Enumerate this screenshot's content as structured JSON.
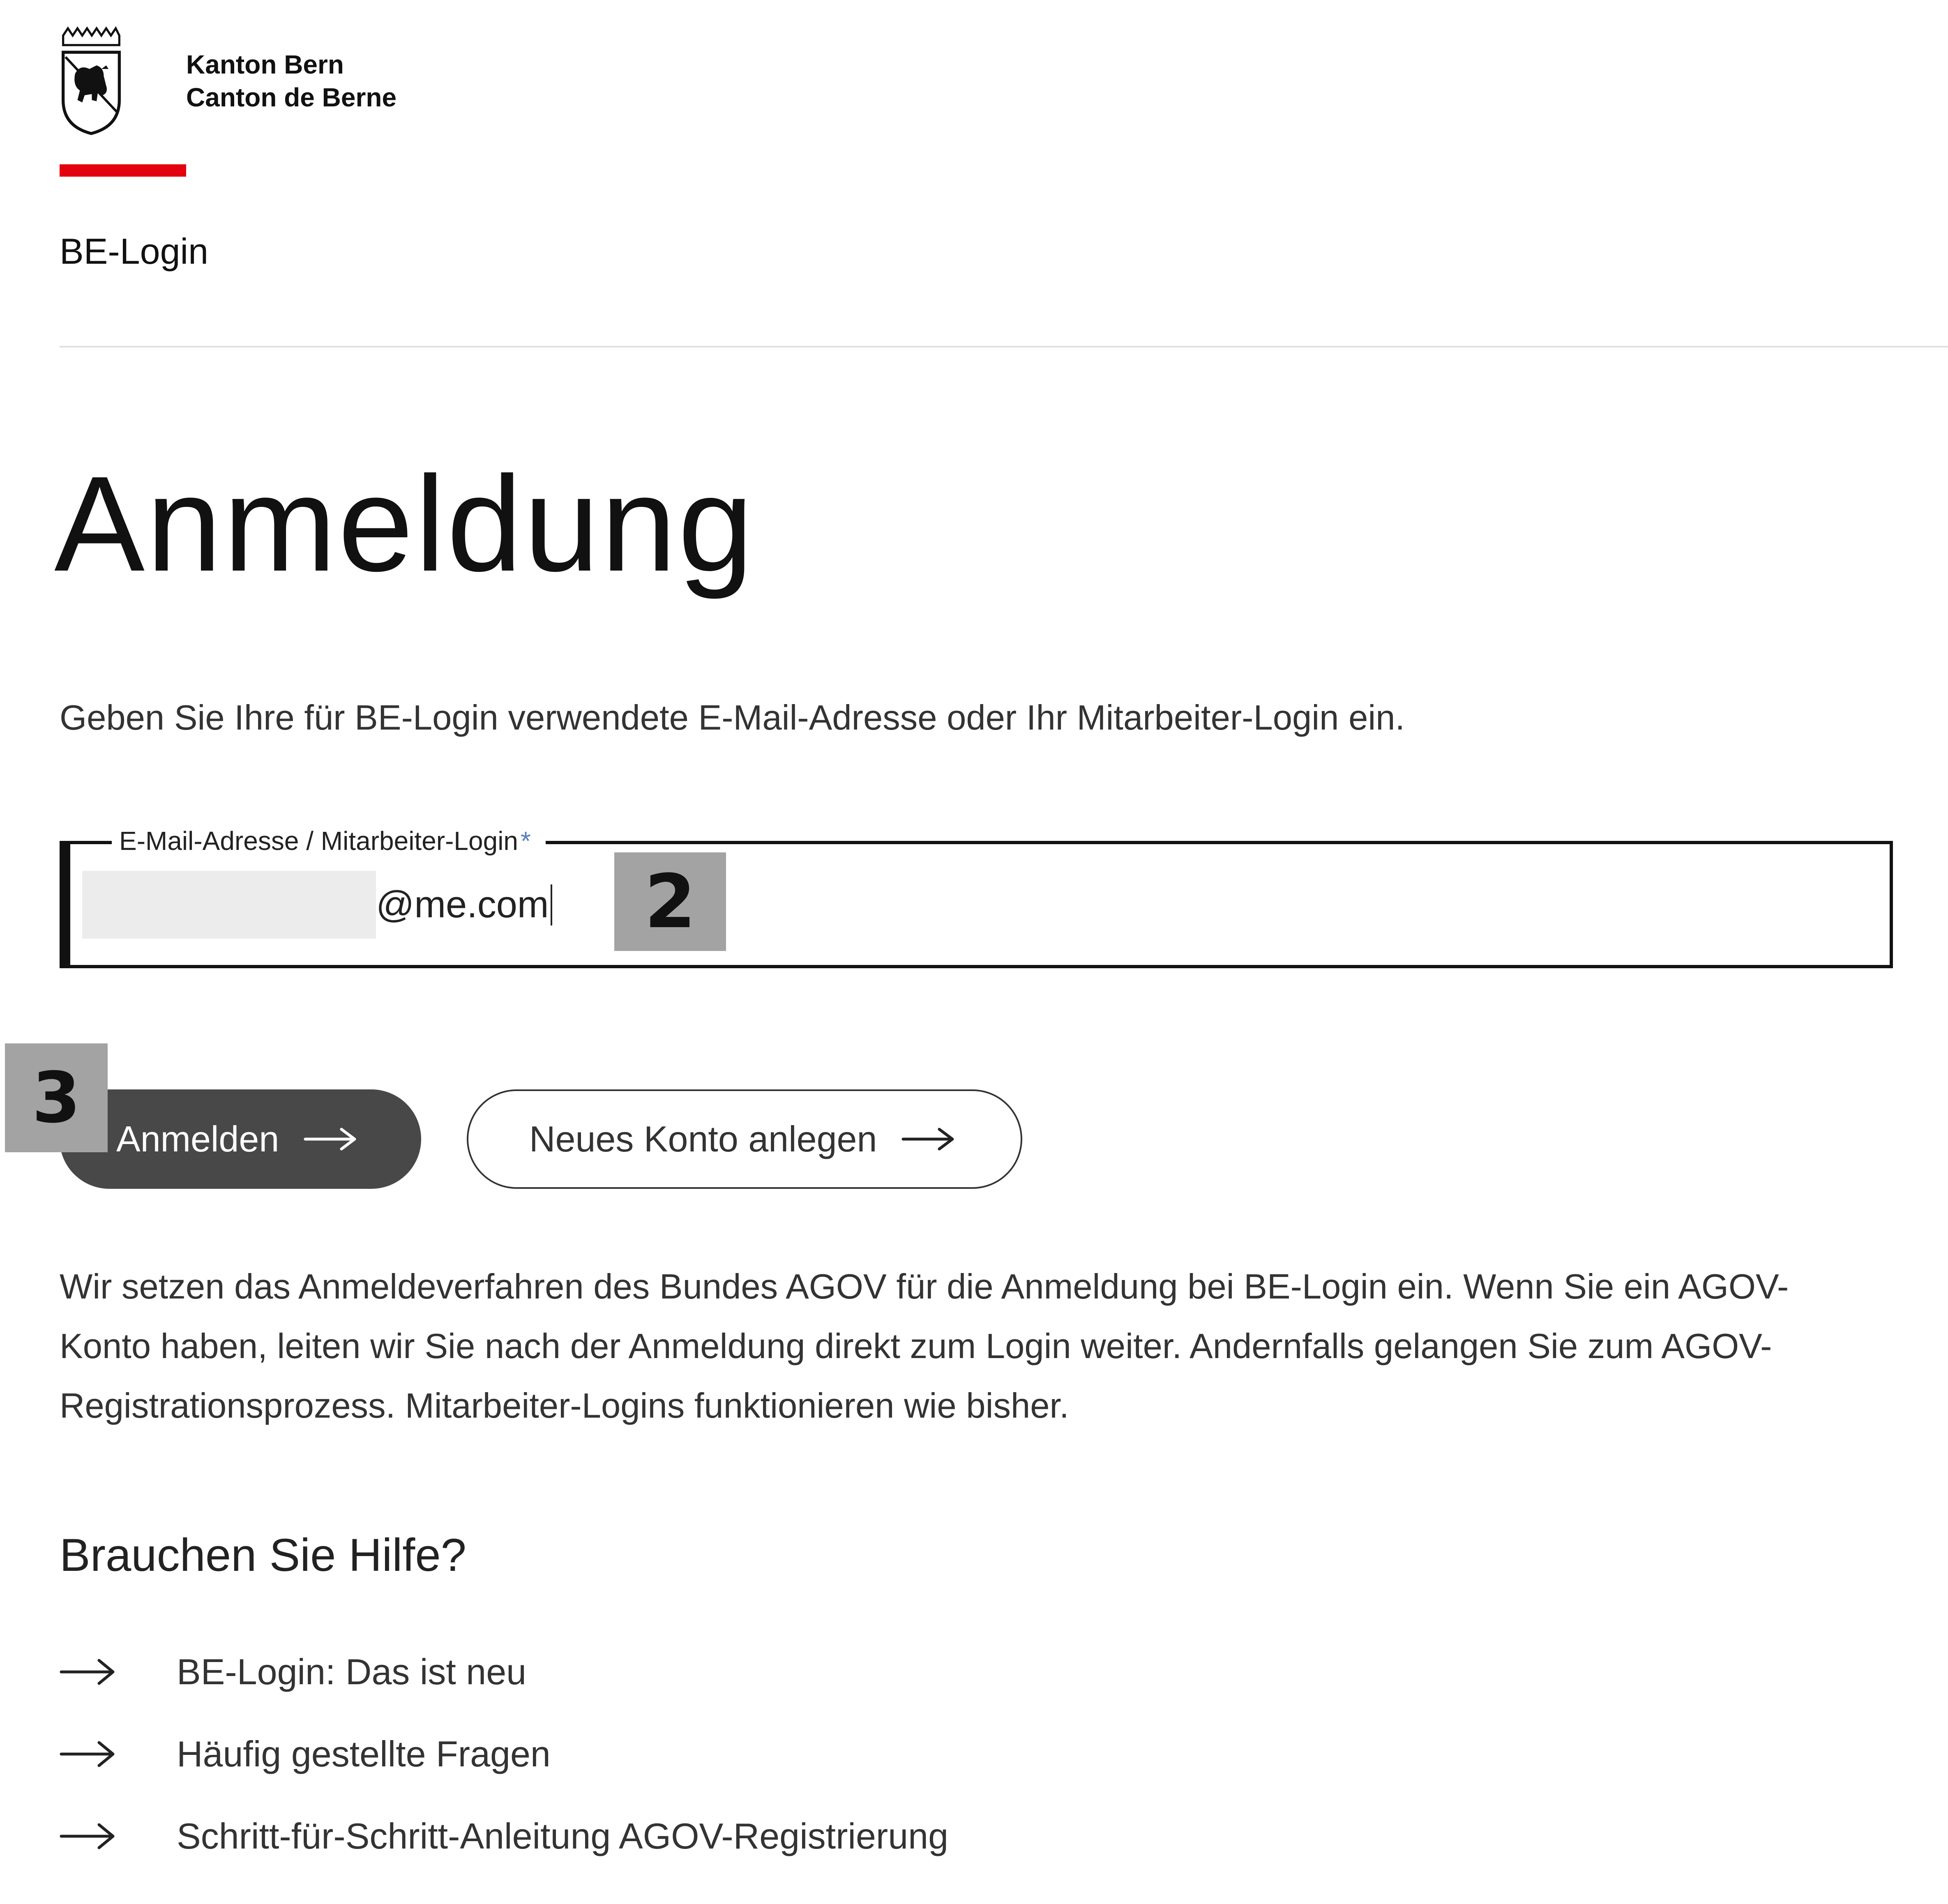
{
  "header": {
    "brand_line_1": "Kanton Bern",
    "brand_line_2": "Canton de Berne",
    "app_name": "BE-Login",
    "accent_color": "#e3000f"
  },
  "main": {
    "title": "Anmeldung",
    "instruction": "Geben Sie Ihre für BE-Login verwendete E-Mail-Adresse oder Ihr Mitarbeiter-Login ein.",
    "email_field": {
      "label": "E-Mail-Adresse / Mitarbeiter-Login",
      "required_marker": "*",
      "value": "@me.com"
    },
    "buttons": {
      "login": "Anmelden",
      "register": "Neues Konto anlegen"
    },
    "info_text": "Wir setzen das Anmeldeverfahren des Bundes AGOV für die Anmeldung bei BE-Login ein. Wenn Sie ein AGOV-Konto haben, leiten wir Sie nach der Anmeldung direkt zum Login weiter. Andernfalls gelangen Sie zum AGOV-Registrationsprozess. Mitarbeiter-Logins funktionieren wie bisher."
  },
  "help": {
    "title": "Brauchen Sie Hilfe?",
    "links": [
      {
        "label": "BE-Login: Das ist neu"
      },
      {
        "label": "Häufig gestellte Fragen"
      },
      {
        "label": "Schritt-für-Schritt-Anleitung AGOV-Registrierung"
      }
    ]
  },
  "annotations": {
    "badge_2": "2",
    "badge_3": "3"
  }
}
